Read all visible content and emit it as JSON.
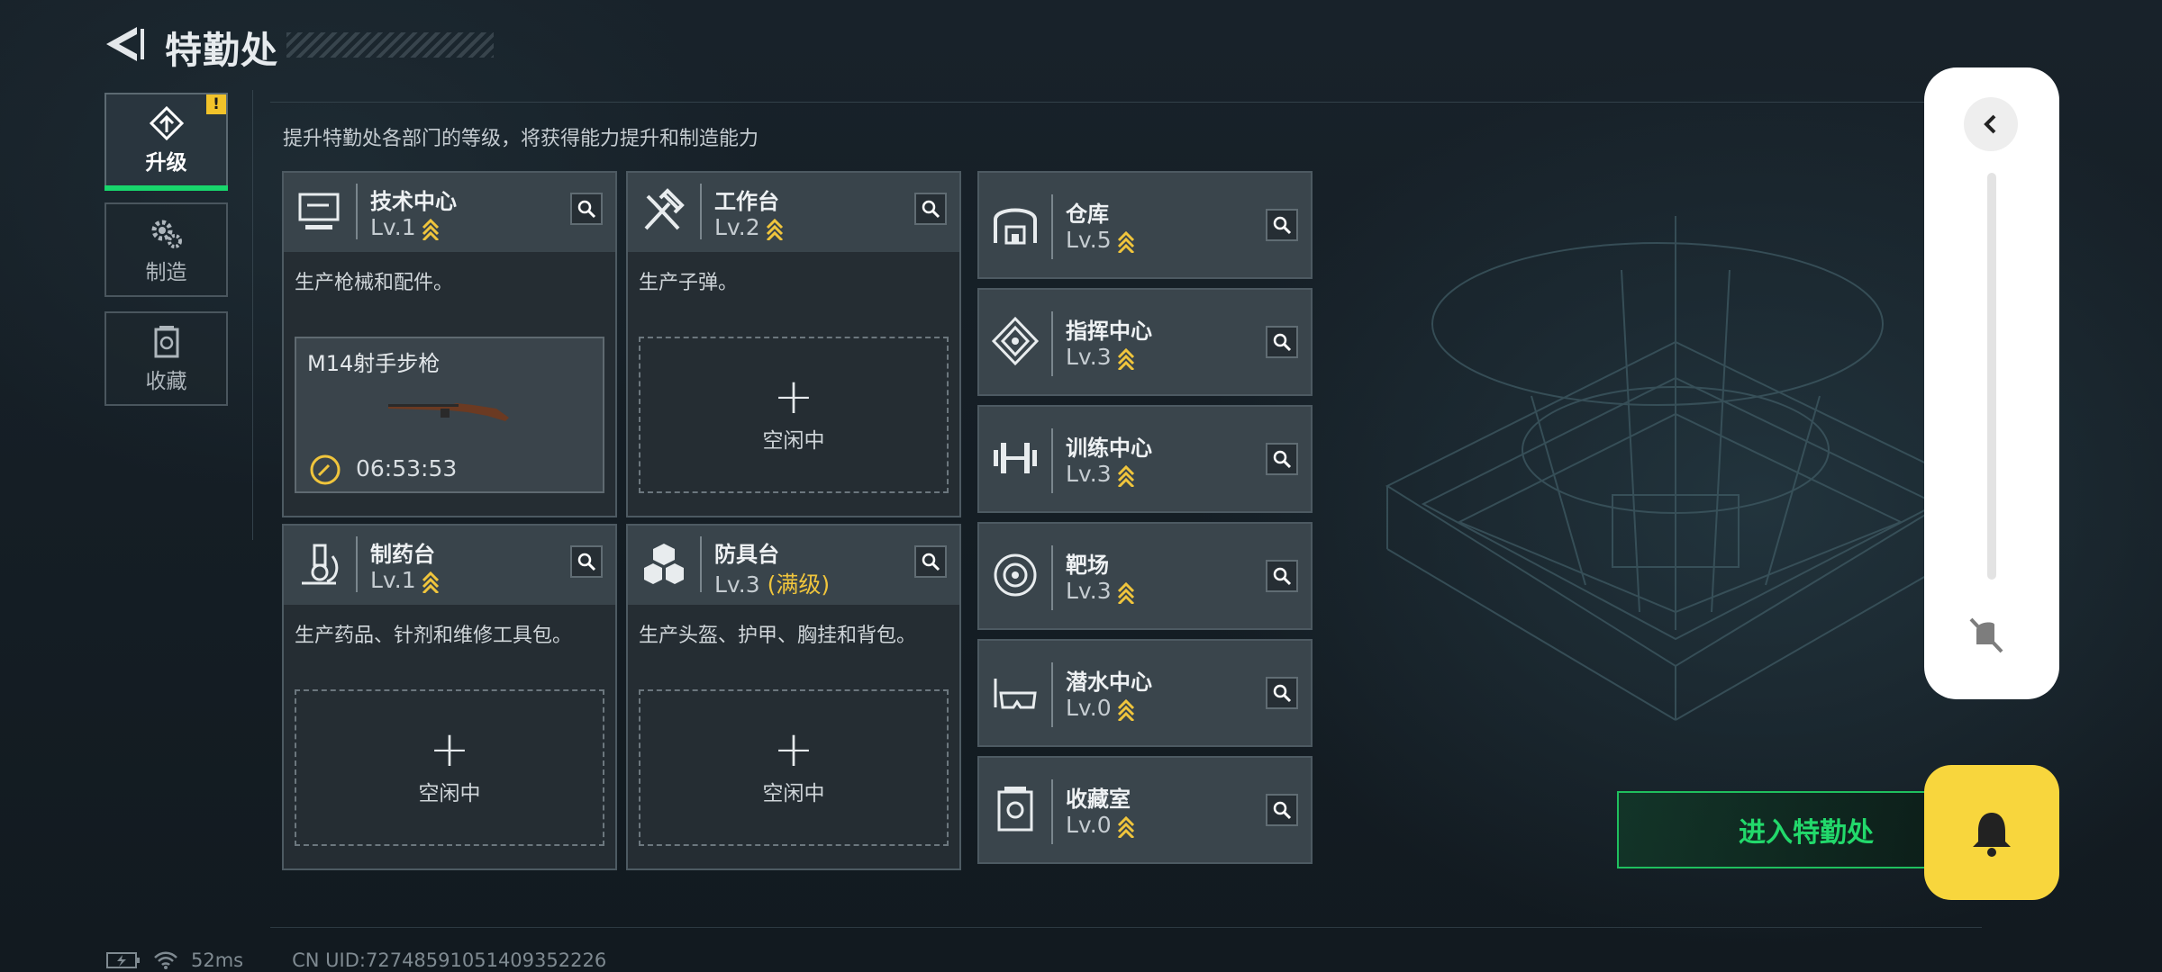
{
  "header": {
    "title": "特勤处"
  },
  "sidebar": {
    "tabs": [
      {
        "label": "升级",
        "icon": "upgrade-icon",
        "active": true,
        "badge": "!"
      },
      {
        "label": "制造",
        "icon": "gears-icon",
        "active": false
      },
      {
        "label": "收藏",
        "icon": "collection-icon",
        "active": false
      }
    ]
  },
  "hint": "提升特勤处各部门的等级，将获得能力提升和制造能力",
  "facilities": {
    "tech_center": {
      "name": "技术中心",
      "level": "Lv.1",
      "desc": "生产枪械和配件。",
      "production": {
        "item": "M14射手步枪",
        "time": "06:53:53"
      }
    },
    "workbench": {
      "name": "工作台",
      "level": "Lv.2",
      "desc": "生产子弹。",
      "slot": "空闲中"
    },
    "pharmacy": {
      "name": "制药台",
      "level": "Lv.1",
      "desc": "生产药品、针剂和维修工具包。",
      "slot": "空闲中"
    },
    "armor_bench": {
      "name": "防具台",
      "level": "Lv.3",
      "max_tag": "(满级)",
      "desc": "生产头盔、护甲、胸挂和背包。",
      "slot": "空闲中"
    }
  },
  "small_facilities": [
    {
      "name": "仓库",
      "level": "Lv.5",
      "icon": "warehouse-icon"
    },
    {
      "name": "指挥中心",
      "level": "Lv.3",
      "icon": "command-center-icon"
    },
    {
      "name": "训练中心",
      "level": "Lv.3",
      "icon": "dumbbell-icon"
    },
    {
      "name": "靶场",
      "level": "Lv.3",
      "icon": "target-icon"
    },
    {
      "name": "潜水中心",
      "level": "Lv.0",
      "icon": "diving-goggles-icon"
    },
    {
      "name": "收藏室",
      "level": "Lv.0",
      "icon": "collection-room-icon"
    }
  ],
  "enter_button": "进入特勤处",
  "status_bar": {
    "ping": "52ms",
    "uid": "CN UID:72748591051409352226"
  },
  "colors": {
    "accent_green": "#1fd66b",
    "level_gold": "#f0c53c",
    "bell_yellow": "#f8d63d"
  }
}
